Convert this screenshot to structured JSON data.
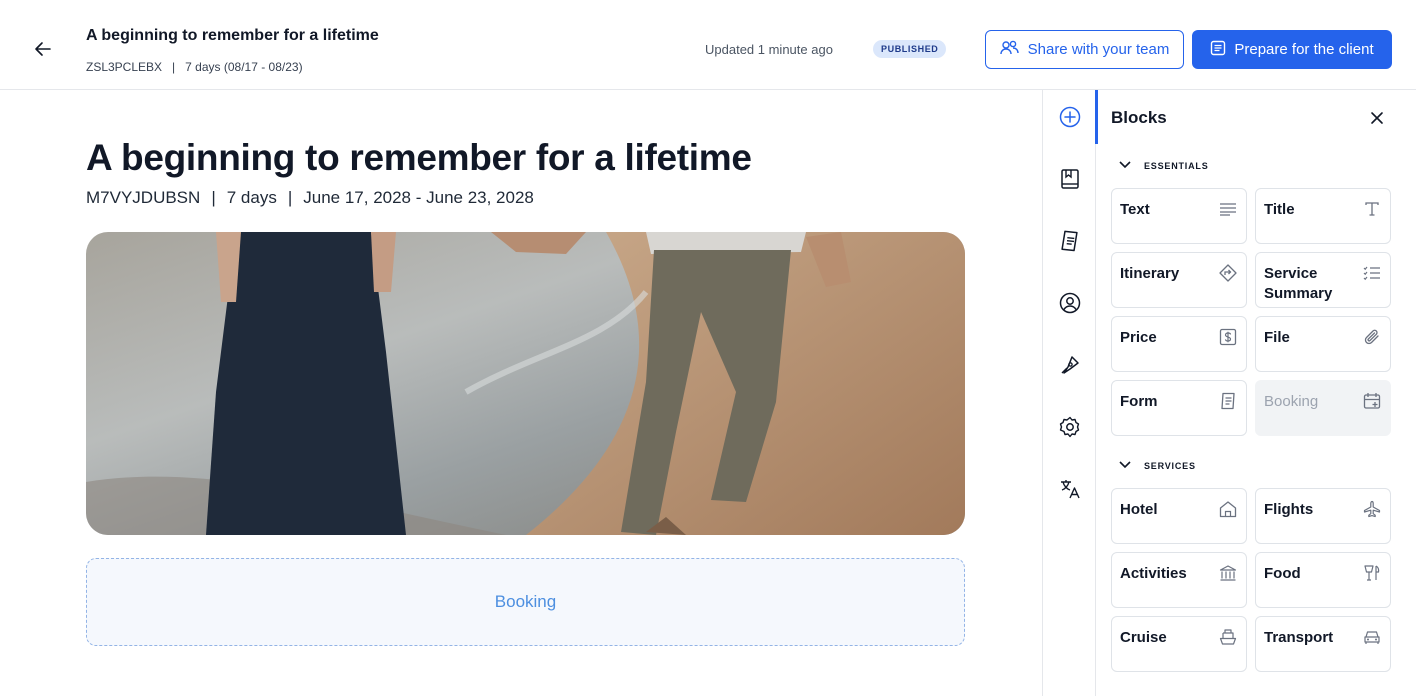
{
  "header": {
    "title": "A beginning to remember for a lifetime",
    "code": "ZSL3PCLEBX",
    "separator": "|",
    "duration": "7 days (08/17 - 08/23)",
    "updated": "Updated 1 minute ago",
    "status_badge": "PUBLISHED",
    "share_button": "Share with your team",
    "prepare_button": "Prepare for the client"
  },
  "main": {
    "title": "A beginning to remember for a lifetime",
    "code": "M7VYJDUBSN",
    "separator": "|",
    "days": "7 days",
    "dates": "June 17, 2028 - June 23, 2028",
    "booking_placeholder": "Booking"
  },
  "rail": {
    "items": [
      "add-icon",
      "book-icon",
      "document-icon",
      "user-circle-icon",
      "pen-icon",
      "gear-icon",
      "translate-icon"
    ]
  },
  "panel": {
    "title": "Blocks",
    "sections": [
      {
        "label": "ESSENTIALS",
        "blocks": [
          {
            "label": "Text",
            "icon": "text-lines-icon"
          },
          {
            "label": "Title",
            "icon": "title-t-icon"
          },
          {
            "label": "Itinerary",
            "icon": "route-diamond-icon"
          },
          {
            "label": "Service Summary",
            "icon": "checklist-icon"
          },
          {
            "label": "Price",
            "icon": "dollar-box-icon"
          },
          {
            "label": "File",
            "icon": "paperclip-icon"
          },
          {
            "label": "Form",
            "icon": "form-icon"
          },
          {
            "label": "Booking",
            "icon": "calendar-plus-icon",
            "disabled": true
          }
        ]
      },
      {
        "label": "SERVICES",
        "blocks": [
          {
            "label": "Hotel",
            "icon": "hotel-icon"
          },
          {
            "label": "Flights",
            "icon": "plane-icon"
          },
          {
            "label": "Activities",
            "icon": "museum-icon"
          },
          {
            "label": "Food",
            "icon": "cutlery-icon"
          },
          {
            "label": "Cruise",
            "icon": "ship-icon"
          },
          {
            "label": "Transport",
            "icon": "car-icon"
          }
        ]
      }
    ]
  },
  "colors": {
    "accent": "#2563eb",
    "badge_bg": "#dbe7fb",
    "drop_zone_text": "#4d8fe0"
  }
}
